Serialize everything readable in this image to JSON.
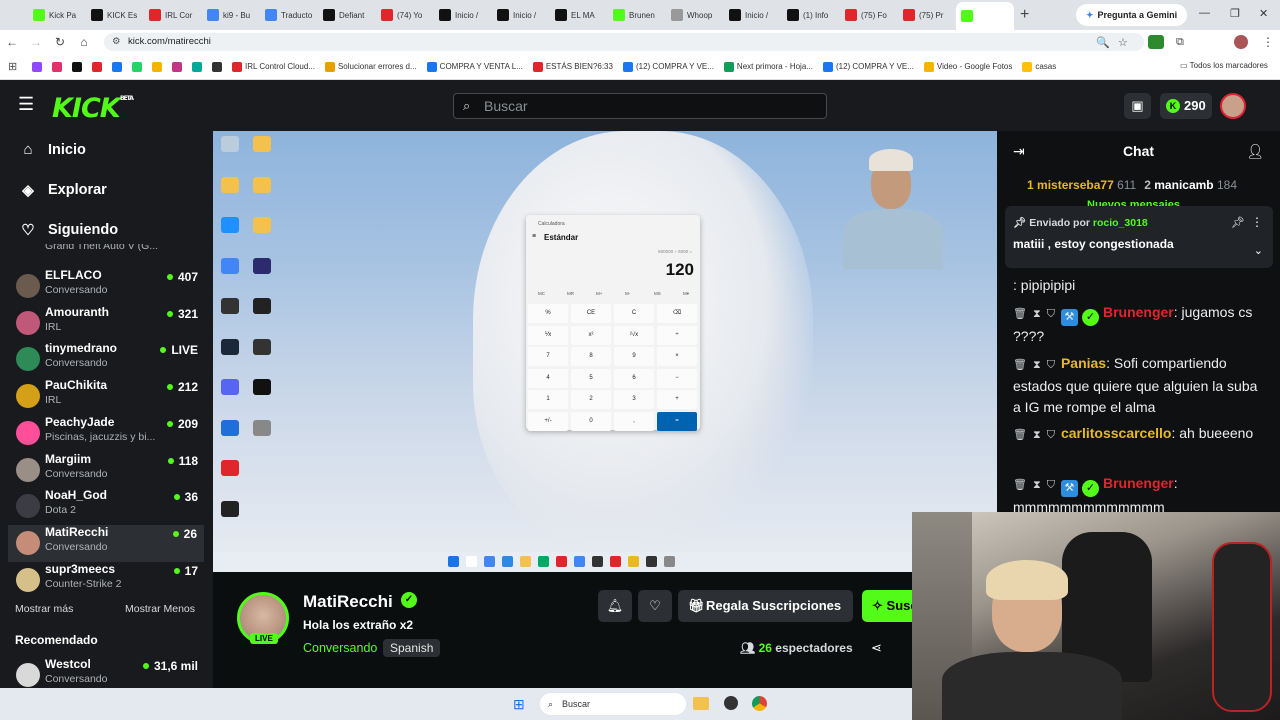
{
  "browser": {
    "tabs": [
      {
        "label": "Kick Pa",
        "color": "#53fc18"
      },
      {
        "label": "KICK Es",
        "color": "#111"
      },
      {
        "label": "IRL Cor",
        "color": "#e0262b"
      },
      {
        "label": "ki9 - Bu",
        "color": "#4285f4"
      },
      {
        "label": "Traducto",
        "color": "#4285f4"
      },
      {
        "label": "Defiant",
        "color": "#111"
      },
      {
        "label": "(74) Yo",
        "color": "#e0262b"
      },
      {
        "label": "Inicio /",
        "color": "#111"
      },
      {
        "label": "Inicio /",
        "color": "#111"
      },
      {
        "label": "EL MA",
        "color": "#111"
      },
      {
        "label": "Brunen",
        "color": "#53fc18"
      },
      {
        "label": "Whoop",
        "color": "#999"
      },
      {
        "label": "Inicio /",
        "color": "#111"
      },
      {
        "label": "(1) Info",
        "color": "#111"
      },
      {
        "label": "(75) Fo",
        "color": "#e0262b"
      },
      {
        "label": "(75) Pr",
        "color": "#e0262b"
      },
      {
        "label": "",
        "color": "#53fc18"
      }
    ],
    "gemini": "Pregunta a Gemini",
    "url": "kick.com/matirecchi",
    "bookmarks": [
      {
        "label": "",
        "color": "#9146ff"
      },
      {
        "label": "",
        "color": "#e1306c"
      },
      {
        "label": "",
        "color": "#111"
      },
      {
        "label": "",
        "color": "#e0262b"
      },
      {
        "label": "",
        "color": "#1877f2"
      },
      {
        "label": "",
        "color": "#25d366"
      },
      {
        "label": "",
        "color": "#f4b400"
      },
      {
        "label": "",
        "color": "#c13584"
      },
      {
        "label": "",
        "color": "#0a9"
      },
      {
        "label": "",
        "color": "#333"
      },
      {
        "label": "IRL Control Cloud...",
        "color": "#e0262b"
      },
      {
        "label": "Solucionar errores d...",
        "color": "#e8a000"
      },
      {
        "label": "COMPRA Y VENTA L...",
        "color": "#1877f2"
      },
      {
        "label": "ESTÁS BIEN?6:33",
        "color": "#e0262b"
      },
      {
        "label": "(12) COMPRA Y VE...",
        "color": "#1877f2"
      },
      {
        "label": "Next primora - Hoja...",
        "color": "#0f9d58"
      },
      {
        "label": "(12) COMPRA Y VE...",
        "color": "#1877f2"
      },
      {
        "label": "Video - Google Fotos",
        "color": "#f4b400"
      },
      {
        "label": "casas",
        "color": "#ffc107"
      }
    ],
    "all_bookmarks": "Todos los marcadores"
  },
  "header": {
    "logo": "KICK",
    "beta": "BETA",
    "search_placeholder": "Buscar",
    "points": "290"
  },
  "sidebar": {
    "nav": [
      {
        "label": "Inicio",
        "icon": "home-icon"
      },
      {
        "label": "Explorar",
        "icon": "compass-icon"
      },
      {
        "label": "Siguiendo",
        "icon": "heart-icon"
      }
    ],
    "partial_item": "Grand Theft Auto V (G...",
    "channels": [
      {
        "name": "ELFLACO",
        "sub": "Conversando",
        "viewers": "407",
        "color": "#6b5a4e"
      },
      {
        "name": "Amouranth",
        "sub": "IRL",
        "viewers": "321",
        "color": "#c0587a"
      },
      {
        "name": "tinymedrano",
        "sub": "Conversando",
        "viewers": "LIVE",
        "color": "#2e8b57"
      },
      {
        "name": "PauChikita",
        "sub": "IRL",
        "viewers": "212",
        "color": "#d4a017"
      },
      {
        "name": "PeachyJade",
        "sub": "Piscinas, jacuzzis y bi...",
        "viewers": "209",
        "color": "#ff4f9a"
      },
      {
        "name": "Margiim",
        "sub": "Conversando",
        "viewers": "118",
        "color": "#9a8f87"
      },
      {
        "name": "NoaH_God",
        "sub": "Dota 2",
        "viewers": "36",
        "color": "#3c3c44"
      },
      {
        "name": "MatiRecchi",
        "sub": "Conversando",
        "viewers": "26",
        "color": "#c58d78"
      },
      {
        "name": "supr3meecs",
        "sub": "Counter-Strike 2",
        "viewers": "17",
        "color": "#d6c08a"
      }
    ],
    "show_more": "Mostrar más",
    "show_less": "Mostrar Menos",
    "recommended": "Recomendado",
    "rec": {
      "name": "Westcol",
      "sub": "Conversando",
      "viewers": "31,6 mil",
      "color": "#d9d9d9"
    }
  },
  "calc": {
    "title": "Calculadora",
    "mode": "Estándar",
    "expr": "600000 ÷ 5000 =",
    "result": "120",
    "mem": [
      "MC",
      "MR",
      "M+",
      "M-",
      "MS",
      "M▾"
    ],
    "keys": [
      "%",
      "CE",
      "C",
      "⌫",
      "⅟x",
      "x²",
      "²√x",
      "÷",
      "7",
      "8",
      "9",
      "×",
      "4",
      "5",
      "6",
      "−",
      "1",
      "2",
      "3",
      "+",
      "+/-",
      "0",
      ",",
      "="
    ]
  },
  "channel": {
    "name": "MatiRecchi",
    "live": "LIVE",
    "title": "Hola los extraño x2",
    "category": "Conversando",
    "language": "Spanish",
    "gift": "Regala Suscripciones",
    "subscribe": "Suscribirse",
    "viewers_num": "26",
    "viewers_label": "espectadores"
  },
  "chat": {
    "title": "Chat",
    "gifters": [
      {
        "rank": "1",
        "name": "misterseba77",
        "count": "611"
      },
      {
        "rank": "2",
        "name": "manicamb",
        "count": "184"
      }
    ],
    "new_messages": "Nuevos mensajes",
    "pinned": {
      "by_label": "Enviado por",
      "by_user": "rocio_3018",
      "message": "matiii , estoy congestionada"
    },
    "messages": [
      {
        "user": "",
        "color": "#fff",
        "text": ": pipipipipi"
      },
      {
        "user": "Brunenger",
        "color": "#e0262b",
        "text": ": jugamos cs ????"
      },
      {
        "user": "Panias",
        "color": "#e8b923",
        "text": ": Sofi compartiendo estados que quiere que alguien la suba a IG me rompe el alma"
      },
      {
        "user": "carlitosscarcello",
        "color": "#e8b923",
        "text": ": ah bueeeno"
      },
      {
        "user": "Brunenger",
        "color": "#e0262b",
        "text": ": mmmmmmmmmmmmm"
      }
    ]
  },
  "taskbar": {
    "search": "Buscar"
  }
}
